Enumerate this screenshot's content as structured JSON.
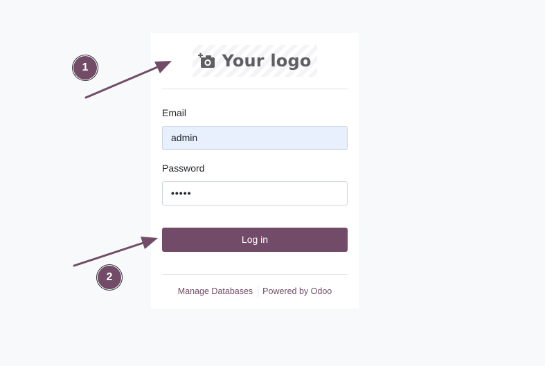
{
  "logo": {
    "text": "Your logo",
    "icon": "camera-plus-icon"
  },
  "form": {
    "email_label": "Email",
    "email_value": "admin",
    "password_label": "Password",
    "password_value": "•••••",
    "login_label": "Log in"
  },
  "footer": {
    "manage_databases": "Manage Databases",
    "powered_by": "Powered by Odoo"
  },
  "annotations": {
    "marker_1": "1",
    "marker_2": "2"
  },
  "colors": {
    "brand": "#714b67",
    "page_background": "#f8f9fb",
    "autofill_background": "#e8f0fe"
  }
}
